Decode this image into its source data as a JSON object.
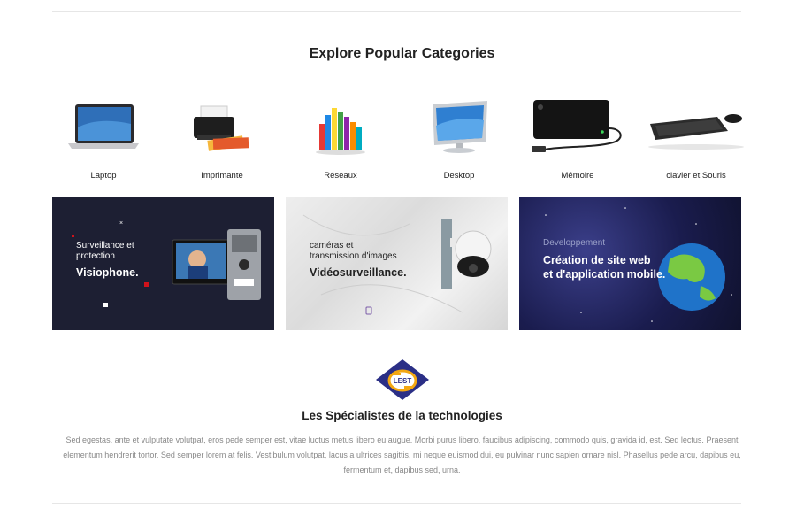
{
  "section_title": "Explore Popular Categories",
  "categories": [
    {
      "label": "Laptop",
      "icon": "laptop-icon"
    },
    {
      "label": "Imprimante",
      "icon": "printer-icon"
    },
    {
      "label": "Réseaux",
      "icon": "network-cables-icon"
    },
    {
      "label": "Desktop",
      "icon": "desktop-monitor-icon"
    },
    {
      "label": "Mémoire",
      "icon": "external-drive-icon"
    },
    {
      "label": "clavier et Souris",
      "icon": "keyboard-mouse-icon"
    }
  ],
  "banners": [
    {
      "subtitle_line1": "Surveillance et",
      "subtitle_line2": "protection",
      "title": "Visiophone.",
      "bg": "#1d1f33",
      "text_color": "#ffffff",
      "accent": "#d0121b"
    },
    {
      "subtitle_line1": "caméras et",
      "subtitle_line2": "transmission d'images",
      "title": "Vidéosurveillance.",
      "bg": "#e6e6e6",
      "text_color": "#222222"
    },
    {
      "subtitle_line1": "Developpement",
      "title_line1": "Création de site web",
      "title_line2": "et d'application mobile.",
      "bg": "#1a1c4e",
      "text_color": "#ffffff"
    }
  ],
  "brand": {
    "logo_text": "LEST",
    "title": "Les Spécialistes de la technologies",
    "description": "Sed egestas, ante et vulputate volutpat, eros pede semper est, vitae luctus metus libero eu augue. Morbi purus libero, faucibus adipiscing, commodo quis, gravida id, est. Sed lectus. Praesent elementum hendrerit tortor. Sed semper lorem at felis. Vestibulum volutpat, lacus a ultrices sagittis, mi neque euismod dui, eu pulvinar nunc sapien ornare nisl. Phasellus pede arcu, dapibus eu, fermentum et, dapibus sed, urna.",
    "logo_color": "#2b2f86",
    "logo_accent": "#f3a712"
  }
}
